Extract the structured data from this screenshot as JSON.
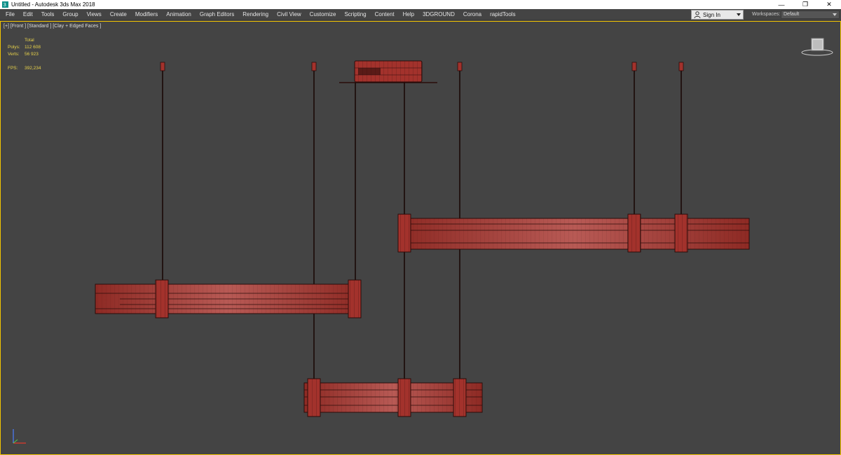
{
  "window": {
    "title": "Untitled - Autodesk 3ds Max 2018",
    "minimize_glyph": "—",
    "maximize_glyph": "❐",
    "close_glyph": "✕"
  },
  "menu": [
    "File",
    "Edit",
    "Tools",
    "Group",
    "Views",
    "Create",
    "Modifiers",
    "Animation",
    "Graph Editors",
    "Rendering",
    "Civil View",
    "Customize",
    "Scripting",
    "Content",
    "Help",
    "3DGROUND",
    "Corona",
    "rapidTools"
  ],
  "account": {
    "sign_in_label": "Sign In"
  },
  "workspaces": {
    "label": "Workspaces:",
    "value": "Default"
  },
  "viewport": {
    "label": "[+] [Front ] [Standard ] [Clay + Edged Faces ]",
    "stats": {
      "header": "Total",
      "polys_label": "Polys:",
      "polys_value": "112 608",
      "verts_label": "Verts:",
      "verts_value": "56 923",
      "fps_label": "FPS:",
      "fps_value": "392,234"
    }
  },
  "colors": {
    "viewport_bg": "#444444",
    "mesh_fill": "#a3322c",
    "mesh_wire": "#2a0c0a",
    "active_border": "#f2c400",
    "stats_text": "#e8d24a"
  },
  "icons": {
    "app": "3dsmax-logo-icon",
    "account": "person-icon",
    "viewcube": "viewcube-icon",
    "axis": "axis-tripod-icon"
  }
}
